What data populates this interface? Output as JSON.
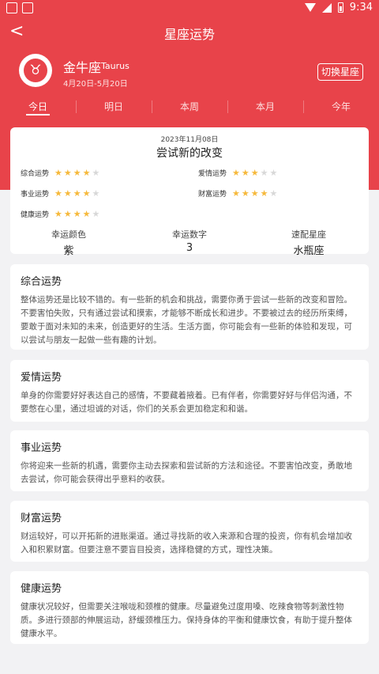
{
  "status": {
    "time": "9:34"
  },
  "nav": {
    "back": "<",
    "title": "星座运势"
  },
  "sign": {
    "name": "金牛座",
    "name_en": "Taurus",
    "dates": "4月20日-5月20日",
    "avatar_glyph": "♉",
    "switch_label": "切换星座"
  },
  "tabs": [
    {
      "label": "今日",
      "active": true
    },
    {
      "label": "明日",
      "active": false
    },
    {
      "label": "本周",
      "active": false
    },
    {
      "label": "本月",
      "active": false
    },
    {
      "label": "今年",
      "active": false
    }
  ],
  "summary": {
    "date": "2023年11月08日",
    "headline": "尝试新的改变",
    "fortunes": [
      {
        "label": "综合运势",
        "stars": 4,
        "max": 5
      },
      {
        "label": "爱情运势",
        "stars": 3,
        "max": 5
      },
      {
        "label": "事业运势",
        "stars": 4,
        "max": 5
      },
      {
        "label": "财富运势",
        "stars": 4,
        "max": 5
      },
      {
        "label": "健康运势",
        "stars": 4,
        "max": 5
      }
    ],
    "lucky": [
      {
        "label": "幸运颜色",
        "value": "紫"
      },
      {
        "label": "幸运数字",
        "value": "3"
      },
      {
        "label": "速配星座",
        "value": "水瓶座"
      }
    ]
  },
  "details": [
    {
      "title": "综合运势",
      "body": "整体运势还是比较不错的。有一些新的机会和挑战，需要你勇于尝试一些新的改变和冒险。不要害怕失败，只有通过尝试和摸索，才能够不断成长和进步。不要被过去的经历所束缚，要敢于面对未知的未来，创造更好的生活。生活方面，你可能会有一些新的体验和发现，可以尝试与朋友一起做一些有趣的计划。"
    },
    {
      "title": "爱情运势",
      "body": "单身的你需要好好表达自己的感情，不要藏着掖着。已有伴者，你需要好好与伴侣沟通，不要憋在心里，通过坦诚的对话，你们的关系会更加稳定和和谐。"
    },
    {
      "title": "事业运势",
      "body": "你将迎来一些新的机遇，需要你主动去探索和尝试新的方法和途径。不要害怕改变，勇敢地去尝试，你可能会获得出乎意料的收获。"
    },
    {
      "title": "财富运势",
      "body": "财运较好，可以开拓新的进账渠道。通过寻找新的收入来源和合理的投资，你有机会增加收入和积累财富。但要注意不要盲目投资，选择稳健的方式，理性决策。"
    },
    {
      "title": "健康运势",
      "body": "健康状况较好，但需要关注喉咙和颈椎的健康。尽量避免过度用嗓、吃辣食物等刺激性物质。多进行颈部的伸展运动，舒缓颈椎压力。保持身体的平衡和健康饮食，有助于提升整体健康水平。"
    }
  ]
}
